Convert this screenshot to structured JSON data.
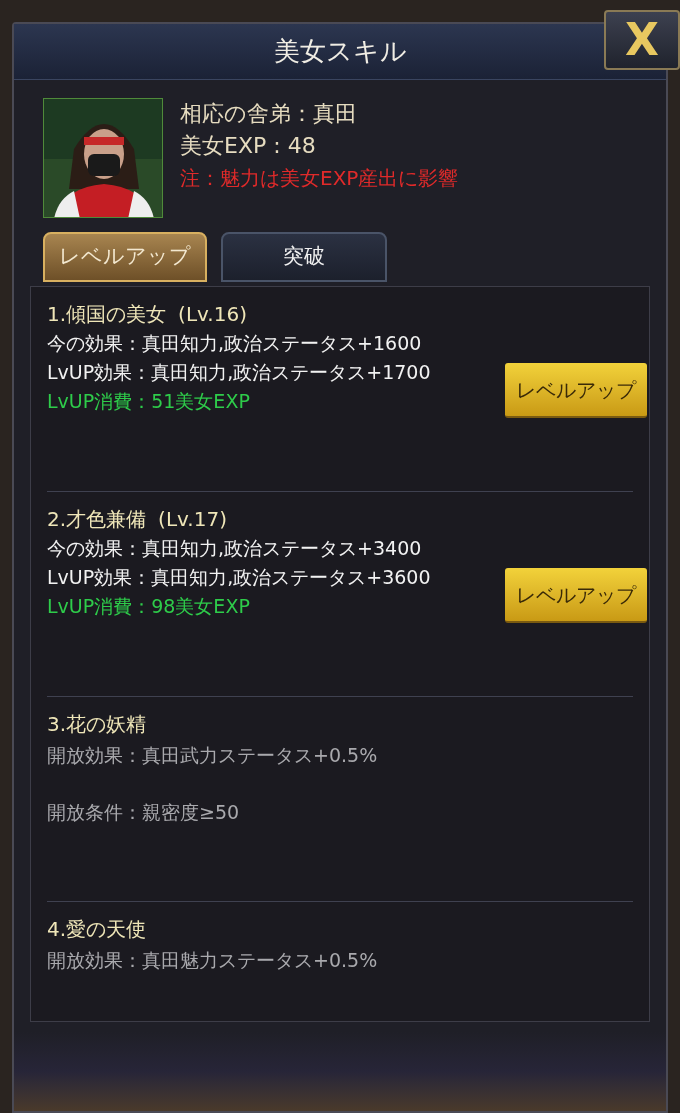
{
  "dialog": {
    "title": "美女スキル",
    "close": "X"
  },
  "profile": {
    "lines": [
      {
        "kind": "info",
        "text": "相応の舎弟：真田"
      },
      {
        "kind": "info",
        "text": "美女EXP : 48"
      },
      {
        "kind": "note",
        "text": "注：魅力は美女EXP産出に影響"
      }
    ]
  },
  "tabs": [
    {
      "label": "レベルアップ",
      "selected": true
    },
    {
      "label": "突破",
      "selected": false
    }
  ],
  "skills": [
    {
      "title": "1.傾国の美女",
      "level": "(Lv.16)",
      "lines": [
        {
          "kind": "effect",
          "text": "今の効果：真田知力,政治ステータス+1600"
        },
        {
          "kind": "effect",
          "text": "LvUP効果：真田知力,政治ステータス+1700"
        },
        {
          "kind": "cost",
          "text": "LvUP消費：51美女EXP"
        }
      ],
      "button": "レベルアップ"
    },
    {
      "title": "2.才色兼備",
      "level": "(Lv.17)",
      "lines": [
        {
          "kind": "effect",
          "text": "今の効果：真田知力,政治ステータス+3400"
        },
        {
          "kind": "effect",
          "text": "LvUP効果：真田知力,政治ステータス+3600"
        },
        {
          "kind": "cost",
          "text": "LvUP消費：98美女EXP"
        }
      ],
      "button": "レベルアップ"
    },
    {
      "title": "3.花の妖精",
      "lines": [
        {
          "kind": "locked",
          "text": "開放効果：真田武力ステータス+0.5%"
        },
        {
          "kind": "condition",
          "text": "開放条件：親密度≥50"
        }
      ]
    },
    {
      "title": "4.愛の天使",
      "lines": [
        {
          "kind": "locked",
          "text": "開放効果：真田魅力ステータス+0.5%"
        }
      ]
    }
  ]
}
